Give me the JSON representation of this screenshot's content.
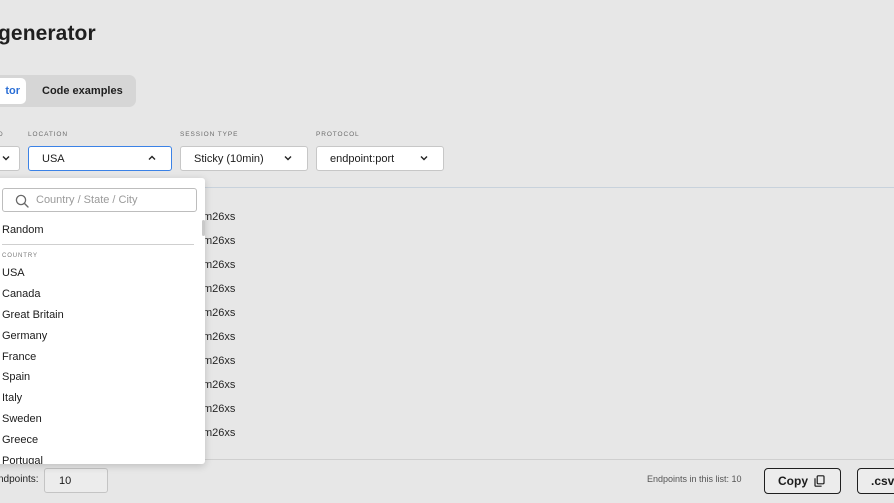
{
  "page": {
    "title": "generator"
  },
  "tabs": [
    {
      "label": "tor",
      "active": true
    },
    {
      "label": "Code examples",
      "active": false
    }
  ],
  "fields": {
    "method": {
      "label": "D"
    },
    "location": {
      "label": "LOCATION",
      "value": "USA"
    },
    "session_type": {
      "label": "SESSION TYPE",
      "value": "Sticky (10min)"
    },
    "protocol": {
      "label": "PROTOCOL",
      "value": "endpoint:port"
    }
  },
  "results": {
    "lines": [
      "m26xs",
      "m26xs",
      "m26xs",
      "m26xs",
      "m26xs",
      "m26xs",
      "m26xs",
      "m26xs",
      "m26xs",
      "m26xs"
    ]
  },
  "dropdown": {
    "search_placeholder": "Country / State / City",
    "random_label": "Random",
    "section_label": "COUNTRY",
    "countries": [
      "USA",
      "Canada",
      "Great Britain",
      "Germany",
      "France",
      "Spain",
      "Italy",
      "Sweden",
      "Greece",
      "Portugal"
    ]
  },
  "footer": {
    "endpoints_label": "ndpoints:",
    "endpoints_value": "10",
    "count_text": "Endpoints in this list: 10",
    "copy_label": "Copy",
    "csv_label": ".csv"
  },
  "colors": {
    "accent": "#3b82e6",
    "tab_active_text": "#2b6fd6",
    "background": "#e7e7e7"
  },
  "icons": {
    "search": "search-icon",
    "chevron_up": "chevron-up-icon",
    "chevron_down": "chevron-down-icon",
    "copy": "copy-icon"
  }
}
